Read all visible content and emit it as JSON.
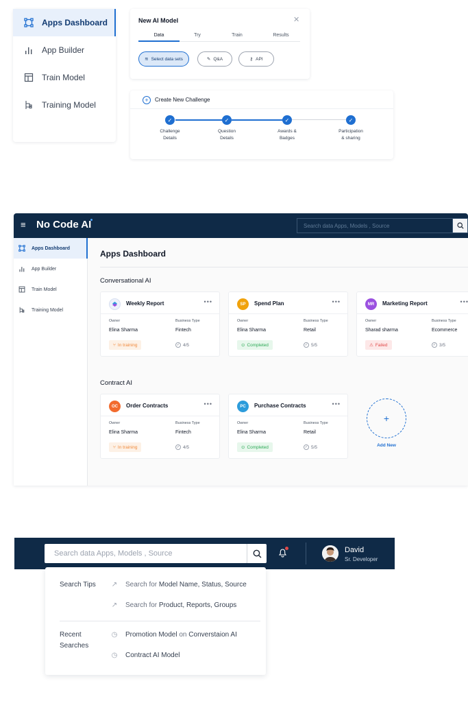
{
  "sidebar_card": {
    "items": [
      {
        "label": "Apps Dashboard",
        "icon": "frame-icon",
        "active": true
      },
      {
        "label": "App Builder",
        "icon": "bar-chart-icon",
        "active": false
      },
      {
        "label": "Train Model",
        "icon": "layout-icon",
        "active": false
      },
      {
        "label": "Training Model",
        "icon": "branch-icon",
        "active": false
      }
    ]
  },
  "model_card": {
    "title": "New AI Model",
    "close_icon": "close-icon",
    "tabs": [
      "Data",
      "Try",
      "Train",
      "Results"
    ],
    "active_tab": "Data",
    "options": [
      {
        "label": "Select data sets",
        "icon": "layers-icon",
        "active": true
      },
      {
        "label": "Q&A",
        "icon": "pencil-icon",
        "active": false
      },
      {
        "label": "API",
        "icon": "key-icon",
        "active": false
      }
    ]
  },
  "challenge_card": {
    "title": "Create New Challenge",
    "steps": [
      "Challenge Details",
      "Question Details",
      "Awards & Badges",
      "Participation & sharing"
    ],
    "steps_lines": [
      [
        "Challenge",
        "Details"
      ],
      [
        "Question",
        "Details"
      ],
      [
        "Awards &",
        "Badges"
      ],
      [
        "Participation",
        "& sharing"
      ]
    ],
    "completed_steps": 4
  },
  "dashboard": {
    "brand": "No Code AI",
    "search_placeholder": "Search data Apps, Models , Source",
    "nav": [
      "Apps Dashboard",
      "App Builder",
      "Train Model",
      "Training Model"
    ],
    "page_title": "Apps Dashboard",
    "sections": [
      {
        "title": "Conversational AI",
        "apps": [
          {
            "initials": "",
            "name": "Weekly Report",
            "owner_label": "Owner",
            "owner": "Elina Sharma",
            "type_label": "Business Type",
            "type": "Fintech",
            "status": "In training",
            "score": "4/5"
          },
          {
            "initials": "SP",
            "name": "Spend Plan",
            "owner_label": "Owner",
            "owner": "Elina Sharma",
            "type_label": "Business Type",
            "type": "Retail",
            "status": "Completed",
            "score": "5/5"
          },
          {
            "initials": "MR",
            "name": "Marketing Report",
            "owner_label": "Owner",
            "owner": "Sharad sharma",
            "type_label": "Business Type",
            "type": "Ecommerce",
            "status": "Failed",
            "score": "3/5"
          }
        ]
      },
      {
        "title": "Contract AI",
        "apps": [
          {
            "initials": "OC",
            "name": "Order Contracts",
            "owner_label": "Owner",
            "owner": "Elina Sharma",
            "type_label": "Business Type",
            "type": "Fintech",
            "status": "In training",
            "score": "4/5"
          },
          {
            "initials": "PC",
            "name": "Purchase Contracts",
            "owner_label": "Owner",
            "owner": "Elina Sharma",
            "type_label": "Business Type",
            "type": "Retail",
            "status": "Completed",
            "score": "5/5"
          }
        ]
      }
    ],
    "add_new": "Add New",
    "colors": {
      "navy": "#0f2a47",
      "accent": "#1f6fd1",
      "sp": "#f0a20c",
      "mr": "#9b51e0",
      "oc": "#f26b2e",
      "pc": "#2d9cdb"
    }
  },
  "search_bar": {
    "placeholder": "Search data Apps, Models , Source",
    "user_name": "David",
    "user_role": "Sr. Developer",
    "dropdown": {
      "tips_heading": "Search Tips",
      "tips": [
        {
          "prefix": "Search for",
          "term": "Model Name, Status, Source"
        },
        {
          "prefix": "Search for",
          "term": "Product, Reports, Groups"
        }
      ],
      "recent_heading_1": "Recent",
      "recent_heading_2": "Searches",
      "recent": [
        {
          "a": "Promotion Model",
          "mid": "on",
          "b": "Converstaion AI"
        },
        {
          "a": "Contract AI Model",
          "mid": "",
          "b": ""
        }
      ]
    }
  }
}
